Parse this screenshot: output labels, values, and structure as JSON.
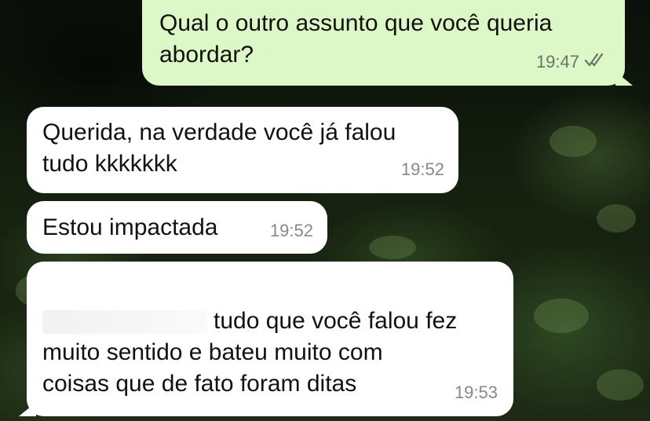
{
  "messages": [
    {
      "direction": "outgoing",
      "text": "Qual o outro assunto que você queria\nabordar?",
      "time": "19:47",
      "status": "read-check-icon"
    },
    {
      "direction": "incoming",
      "text": "Querida, na verdade você já falou\ntudo kkkkkkk",
      "time": "19:52"
    },
    {
      "direction": "incoming",
      "text": "Estou impactada",
      "time": "19:52"
    },
    {
      "direction": "incoming",
      "text_after_redaction": "tudo que você falou fez\nmuito sentido e bateu muito com\ncoisas que de fato foram ditas",
      "time": "19:53"
    }
  ],
  "colors": {
    "outgoing_bubble": "#dcf8c6",
    "incoming_bubble": "#ffffff",
    "timestamp": "#6b7368"
  }
}
